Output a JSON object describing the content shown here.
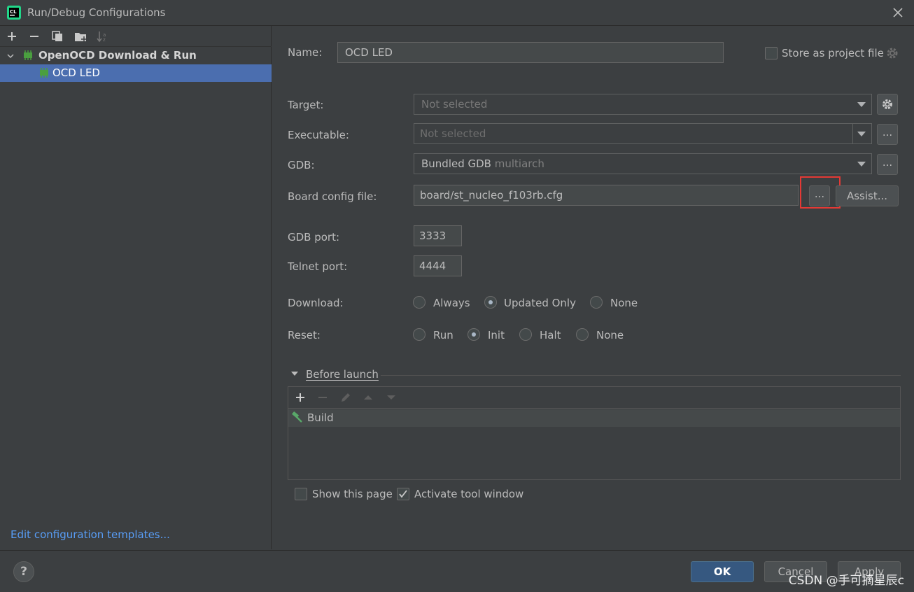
{
  "window": {
    "title": "Run/Debug Configurations"
  },
  "tree": {
    "group_label": "OpenOCD Download & Run",
    "item_label": "OCD LED"
  },
  "sidebar": {
    "templates_link": "Edit configuration templates..."
  },
  "form": {
    "name_label": "Name:",
    "name_value": "OCD LED",
    "store_label": "Store as project file",
    "target_label": "Target:",
    "target_value": "Not selected",
    "executable_label": "Executable:",
    "executable_value": "Not selected",
    "gdb_label": "GDB:",
    "gdb_value": "Bundled GDB",
    "gdb_suffix": "multiarch",
    "board_label": "Board config file:",
    "board_value": "board/st_nucleo_f103rb.cfg",
    "browse_label": "...",
    "assist_label": "Assist...",
    "gdb_port_label": "GDB port:",
    "gdb_port_value": "3333",
    "telnet_port_label": "Telnet port:",
    "telnet_port_value": "4444",
    "download_label": "Download:",
    "download_options": [
      "Always",
      "Updated Only",
      "None"
    ],
    "download_selected": "Updated Only",
    "reset_label": "Reset:",
    "reset_options": [
      "Run",
      "Init",
      "Halt",
      "None"
    ],
    "reset_selected": "Init"
  },
  "before_launch": {
    "title": "Before launch",
    "items": [
      "Build"
    ],
    "show_page_label": "Show this page",
    "show_page_checked": false,
    "activate_label": "Activate tool window",
    "activate_checked": true
  },
  "footer": {
    "help_label": "?",
    "ok_label": "OK",
    "cancel_label": "Cancel",
    "apply_label": "Apply",
    "watermark": "CSDN @手可摘星辰c"
  },
  "colors": {
    "accent": "#4b6eaf",
    "primary_button": "#365880",
    "highlight": "#e53935",
    "link": "#589df6"
  }
}
